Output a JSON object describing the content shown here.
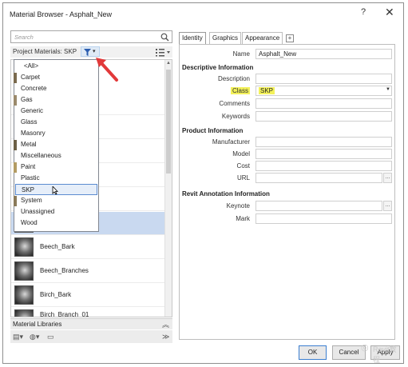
{
  "window": {
    "title": "Material Browser - Asphalt_New",
    "help_label": "?",
    "close_label": "✕"
  },
  "left": {
    "search_placeholder": "Search",
    "project_materials_label": "Project Materials: SKP",
    "filter_chevron": "▾",
    "filter_menu": {
      "all_label": "<All>",
      "items": [
        "Carpet",
        "Concrete",
        "Gas",
        "Generic",
        "Glass",
        "Masonry",
        "Metal",
        "Miscellaneous",
        "Paint",
        "Plastic",
        "SKP",
        "System",
        "Unassigned",
        "Wood"
      ],
      "selected": "SKP"
    },
    "materials": [
      "Beech_Bark",
      "Beech_Branches",
      "Birch_Bark",
      "Birch_Branch_01"
    ],
    "library_bar_label": "Material Libraries",
    "collapse_label": "≫"
  },
  "right": {
    "tabs": [
      "Identity",
      "Graphics",
      "Appearance"
    ],
    "tab_add_label": "+",
    "name_label": "Name",
    "name_value": "Asphalt_New",
    "descriptive_header": "Descriptive Information",
    "description_label": "Description",
    "class_label": "Class",
    "class_value": "SKP",
    "comments_label": "Comments",
    "keywords_label": "Keywords",
    "product_header": "Product Information",
    "manufacturer_label": "Manufacturer",
    "model_label": "Model",
    "cost_label": "Cost",
    "url_label": "URL",
    "annotation_header": "Revit Annotation Information",
    "keynote_label": "Keynote",
    "mark_label": "Mark",
    "dots_label": "..."
  },
  "footer": {
    "ok_label": "OK",
    "cancel_label": "Cancel",
    "apply_label": "Apply",
    "watermark": "Revit教程"
  },
  "colors": {
    "highlight": "#f3f15a",
    "selection": "#c9d9f0",
    "arrow": "#e2393a"
  }
}
